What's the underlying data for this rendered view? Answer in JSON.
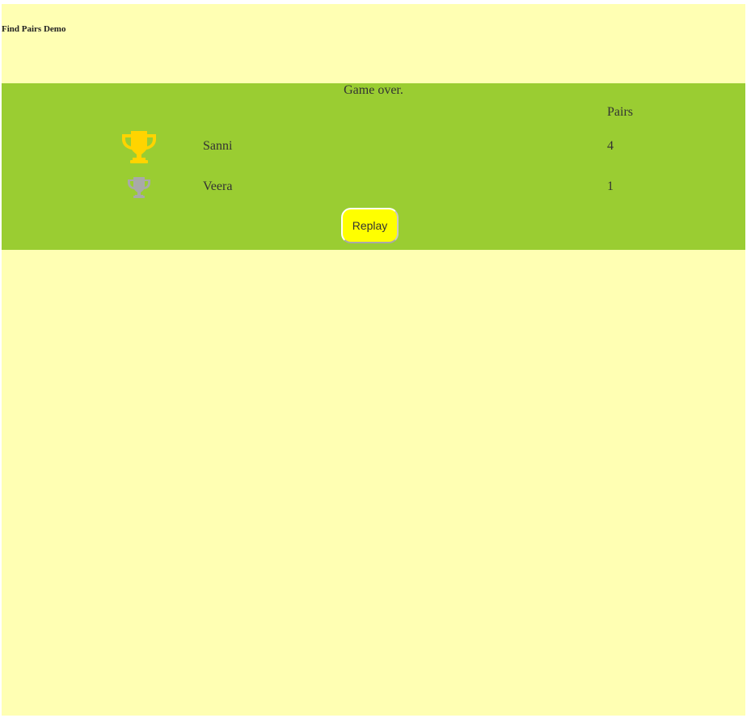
{
  "app": {
    "title": "Find Pairs Demo"
  },
  "results": {
    "status": "Game over.",
    "pairs_header": "Pairs",
    "players": [
      {
        "name": "Sanni",
        "pairs": "4",
        "trophy_icon": "gold-trophy-icon",
        "trophy_color": "#ffd400"
      },
      {
        "name": "Veera",
        "pairs": "1",
        "trophy_icon": "silver-trophy-icon",
        "trophy_color": "#a9a9a9"
      }
    ],
    "replay_label": "Replay"
  },
  "colors": {
    "page_background": "#ffffb3",
    "panel_background": "#9acd32",
    "button_background": "#ffff00"
  }
}
